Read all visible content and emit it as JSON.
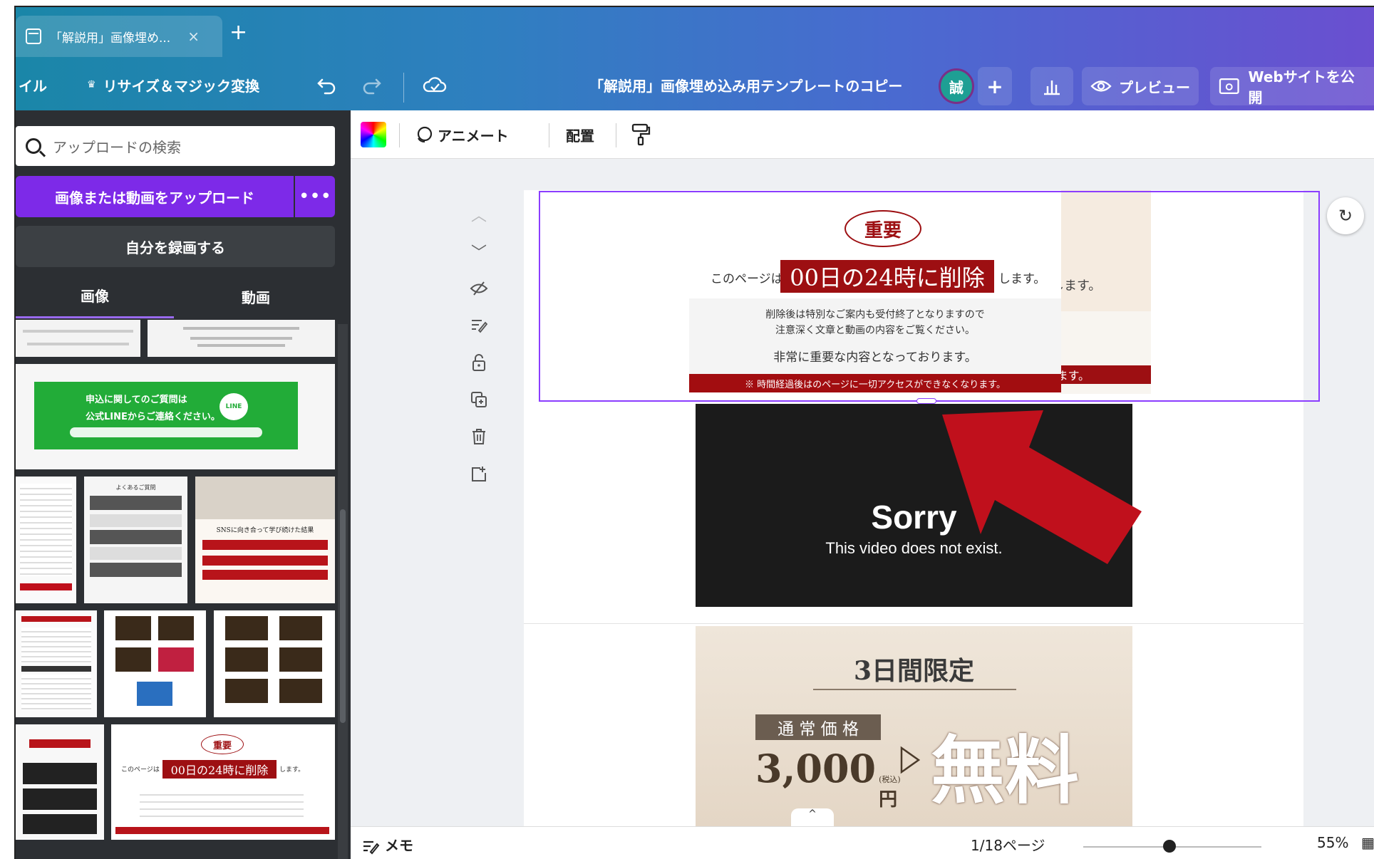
{
  "browser": {
    "tab_title": "「解説用」画像埋め...",
    "tab_close": "×",
    "new_tab": "+"
  },
  "toolbar": {
    "file_label": "イル",
    "resize_label": "リサイズ＆マジック変換",
    "undo_icon": "undo-icon",
    "redo_icon": "redo-icon",
    "design_title": "「解説用」画像埋め込み用テンプレートのコピー",
    "avatar_initial": "誠",
    "add_label": "+",
    "preview_label": "プレビュー",
    "publish_label": "Webサイトを公開"
  },
  "sidebar": {
    "search_placeholder": "アップロードの検索",
    "upload_label": "画像または動画をアップロード",
    "upload_more": "•••",
    "record_label": "自分を録画する",
    "tabs": [
      "画像",
      "動画"
    ],
    "line_banner_line1": "申込に関してのご質問は",
    "line_banner_line2": "公式LINEからご連絡ください。",
    "line_logo": "LINE",
    "thumb_important": "重要",
    "thumb_page_prefix": "このページは",
    "thumb_deadline": "00日の24時に削除",
    "thumb_suffix": "します。",
    "thumb_faq": "よくあるご質問",
    "thumb_sns_title": "SNSに向き合って学び続けた結果"
  },
  "context_bar": {
    "animate_label": "アニメート",
    "position_label": "配置"
  },
  "page": {
    "important_badge": "重要",
    "this_page": "このページは",
    "deadline": "00日の24時に削除",
    "suffix": "します。",
    "notice_line1": "削除後は特別なご案内も受付終了となりますので",
    "notice_line2": "注意深く文章と動画の内容をご覧ください。",
    "notice_line3": "非常に重要な内容となっております。",
    "notice_bar": "※ 時間経過後はのページに一切アクセスができなくなります。",
    "behind_suffix": "します。",
    "behind_bar": "ます。",
    "video_title": "Sorry",
    "video_message": "This video does not exist.",
    "limited": "3日間限定",
    "regular_price_label": "通 常 価 格",
    "price": "3,000",
    "tax_note": "(税込)",
    "yen": "円",
    "free": "無料"
  },
  "footer": {
    "notes_label": "メモ",
    "page_indicator": "1/18ページ",
    "zoom": "55%"
  },
  "colors": {
    "accent_purple": "#7d2ae8",
    "deadline_red": "#9d0f12",
    "arrow_red": "#c0101c"
  }
}
